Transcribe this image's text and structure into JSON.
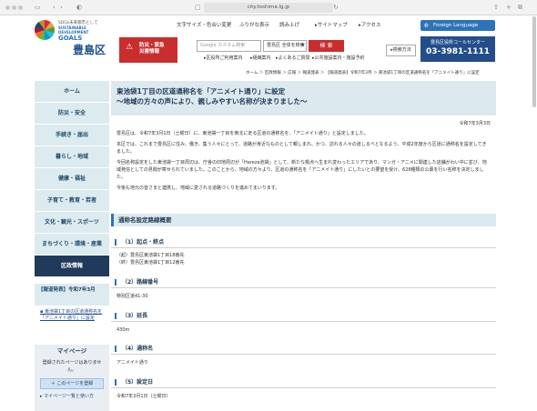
{
  "browser": {
    "url": "city.toshima.lg.jp"
  },
  "header": {
    "logo_tag": "SDGs未来都市として",
    "logo_sdg_line1": "SUSTAINABLE",
    "logo_sdg_line2": "DEVELOPMENT",
    "logo_sdg_line3": "GOALS",
    "logo_city": "豊島区",
    "util_links": [
      "文字サイズ・色合い変更",
      "ふりがな表示",
      "読み上げ",
      "サイトマップ",
      "アクセス"
    ],
    "foreign_language": "Foreign Language",
    "emergency_line1": "防災・緊急",
    "emergency_line2": "災害情報",
    "search_placeholder": "Google カスタム検索",
    "search_scope": "豊島区 全体を検索",
    "search_button": "検 索",
    "links": [
      "区役所ご利用案内",
      "組織案内",
      "よくあるご質問",
      "公共施設案内・施設予約"
    ],
    "advanced_search": "検索方法",
    "call_center_label": "豊島区役所コールセンター",
    "call_center_number": "03-3981-1111"
  },
  "breadcrumb": "ホーム ＞ 区政情報 ＞ 広報 ＞ 報道発表 ＞ 【報道発表】令和7年3月 ＞ 東池袋1丁目の区道通称名を「アニメイト通り」に設定",
  "sidebar": {
    "items": [
      {
        "label": "ホーム"
      },
      {
        "label": "防災・安全"
      },
      {
        "label": "手続き・届出"
      },
      {
        "label": "暮らし・地域"
      },
      {
        "label": "健康・福祉"
      },
      {
        "label": "子育て・教育・若者"
      },
      {
        "label": "文化・観光・スポーツ"
      },
      {
        "label": "まちづくり・環境・産業"
      },
      {
        "label": "区政情報"
      }
    ],
    "sub_heading": "【報道発表】令和7年3月",
    "sub_link": "東池袋1丁目の区道通称名を「アニメイト通り」に設定",
    "mypage_title": "マイページ",
    "mypage_empty": "登録されたページはありません。",
    "mypage_register": "このページを登録",
    "mypage_list": "マイページ一覧と使い方"
  },
  "article": {
    "title_line1": "東池袋1丁目の区道通称名を「アニメイト通り」に設定",
    "title_line2": "～地域の方々の声により、親しみやすい名称が決まりました～",
    "date": "令和7年3月3日",
    "p1": "豊島区は、令和7年3月1日（土曜日）に、東池袋一丁目を南北に走る区道の通称名を、「アニメイト通り」と設定しました。",
    "p2": "本区では、これまで豊島区に住み、働き、集う人々にとって、道路が身近なものとして親しまれ、かつ、訪れる人々の道しるべとなるよう、平成2年度から区道に通称名を設定してきました。",
    "p3": "今回名称設定をした東池袋一丁目周辺は、庁舎の旧地周辺が「Hareza池袋」として、新たな拠点へ生まれ変わったエリアであり、マンガ・アニメに関連した店舗がわい中に並び、地域発信としての見聞が寄せられていました。このことから、地域の方々より、区道の通称名を「アニメイト通り」にしたいとの要望を受け、628種類の公募を行い名称を決定しました。",
    "p4": "今後も地元の皆さまと連携し、地域に愛される道路づくりを進めてまいります。",
    "section_title": "通称名設定路線概要",
    "subs": [
      {
        "num": "（1）起点・終点",
        "value1": "（起）豊島区東池袋1丁目18番先",
        "value2": "（終）豊島区東池袋1丁目12番先"
      },
      {
        "num": "（2）路線番号",
        "value1": "特別区道41-30",
        "value2": ""
      },
      {
        "num": "（3）延長",
        "value1": "430m",
        "value2": ""
      },
      {
        "num": "（4）通称名",
        "value1": "アニメイト通り",
        "value2": ""
      },
      {
        "num": "（5）設定日",
        "value1": "令和7年3月1日（土曜日）",
        "value2": ""
      }
    ]
  },
  "colors": {
    "nav_bg": "#dcebef",
    "nav_active": "#1f3a5a",
    "accent_blue": "#2d73b9",
    "emergency_red": "#c82e2e",
    "call_center": "#234e8a"
  }
}
